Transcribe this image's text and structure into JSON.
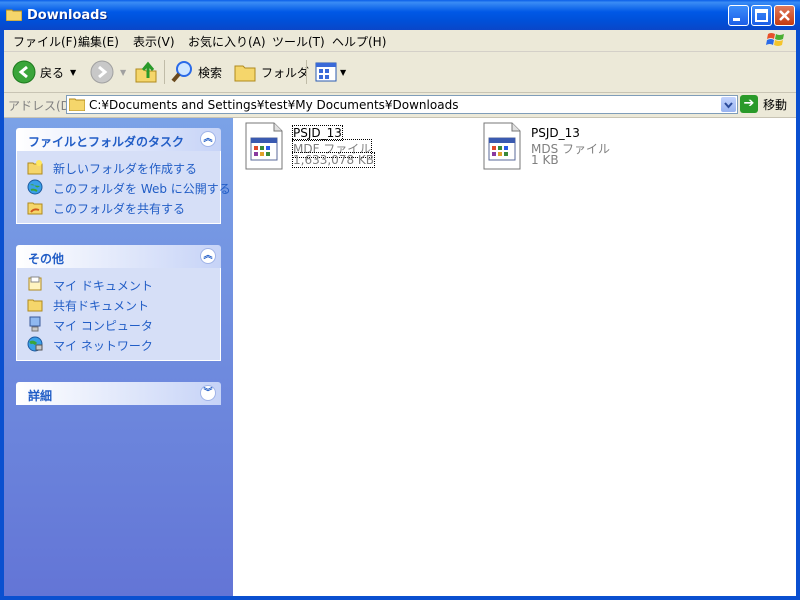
{
  "window": {
    "title": "Downloads"
  },
  "menu": [
    "ファイル(F)",
    "編集(E)",
    "表示(V)",
    "お気に入り(A)",
    "ツール(T)",
    "ヘルプ(H)"
  ],
  "toolbar": {
    "back": "戻る",
    "search": "検索",
    "folders": "フォルダ"
  },
  "address": {
    "label": "アドレス(D)",
    "path": "C:¥Documents and Settings¥test¥My Documents¥Downloads",
    "go": "移動"
  },
  "panels": {
    "tasks": {
      "title": "ファイルとフォルダのタスク",
      "items": [
        "新しいフォルダを作成する",
        "このフォルダを Web に公開する",
        "このフォルダを共有する"
      ]
    },
    "other": {
      "title": "その他",
      "items": [
        "マイ ドキュメント",
        "共有ドキュメント",
        "マイ コンピュータ",
        "マイ ネットワーク"
      ]
    },
    "details": {
      "title": "詳細"
    }
  },
  "files": [
    {
      "name": "PSJD_13",
      "type": "MDF ファイル",
      "size": "1,633,078 KB"
    },
    {
      "name": "PSJD_13",
      "type": "MDS ファイル",
      "size": "1 KB"
    }
  ],
  "colors": {
    "titlebar": "#0058e6",
    "panel_link": "#215dc6",
    "leftpane": "#7ba2e7"
  }
}
